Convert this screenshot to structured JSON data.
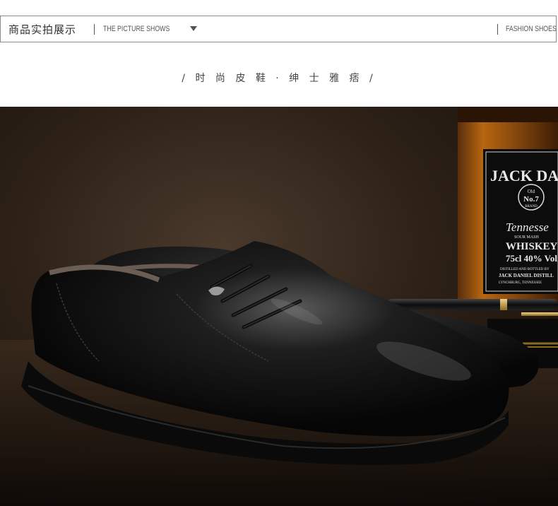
{
  "header": {
    "title_cn": "商品实拍展示",
    "title_en": "THE PICTURE SHOWS",
    "right_label": "FASHION SHOES"
  },
  "tagline": "/ 时 尚 皮 鞋 · 绅 士 雅 痞 /",
  "photo": {
    "bottle_label": {
      "brand_line1": "JACK DANI",
      "badge_line1": "Old",
      "badge_line2": "No.7",
      "badge_line3": "BRAND",
      "line_tennessee": "Tennesse",
      "line_sour_mash": "SOUR MASH",
      "line_whiskey": "WHISKEY",
      "line_volume": "75cl 40% Vol",
      "line_distilled": "DISTILLED AND BOTTLED BY",
      "line_distillery": "JACK DANIEL DISTILL",
      "line_lynchburg": "LYNCHBURG, TENNESSEE"
    }
  }
}
